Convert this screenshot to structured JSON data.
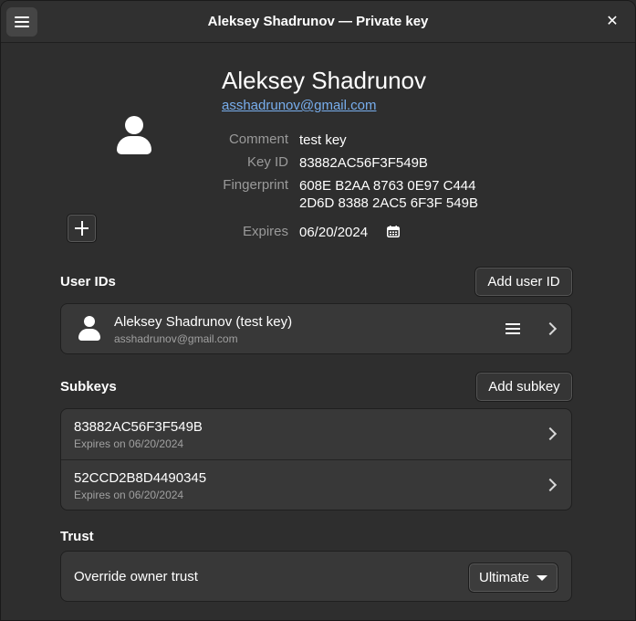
{
  "window": {
    "title": "Aleksey Shadrunov — Private key",
    "close_glyph": "✕"
  },
  "identity": {
    "name": "Aleksey Shadrunov",
    "email": "asshadrunov@gmail.com"
  },
  "details": {
    "comment_label": "Comment",
    "comment_value": "test key",
    "keyid_label": "Key ID",
    "keyid_value": "83882AC56F3F549B",
    "fingerprint_label": "Fingerprint",
    "fingerprint_line1": "608E B2AA 8763 0E97 C444",
    "fingerprint_line2": "2D6D 8388 2AC5 6F3F 549B",
    "expires_label": "Expires",
    "expires_value": "06/20/2024"
  },
  "user_ids": {
    "section_title": "User IDs",
    "add_button": "Add user ID",
    "items": [
      {
        "title": "Aleksey Shadrunov (test key)",
        "subtitle": "asshadrunov@gmail.com"
      }
    ]
  },
  "subkeys": {
    "section_title": "Subkeys",
    "add_button": "Add subkey",
    "items": [
      {
        "title": "83882AC56F3F549B",
        "subtitle": "Expires on 06/20/2024"
      },
      {
        "title": "52CCD2B8D4490345",
        "subtitle": "Expires on 06/20/2024"
      }
    ]
  },
  "trust": {
    "section_title": "Trust",
    "row_label": "Override owner trust",
    "selected_value": "Ultimate"
  },
  "icons": {
    "menu": "hamburger-menu-icon",
    "close": "close-icon",
    "avatar": "avatar-person-icon",
    "add": "plus-icon",
    "calendar": "calendar-icon",
    "list": "list-menu-icon",
    "chevron": "chevron-right-icon",
    "dropdown": "caret-down-icon"
  },
  "colors": {
    "background": "#2e2e2e",
    "card": "#383838",
    "link": "#78aeed",
    "dim_text": "#9a9a9a"
  }
}
